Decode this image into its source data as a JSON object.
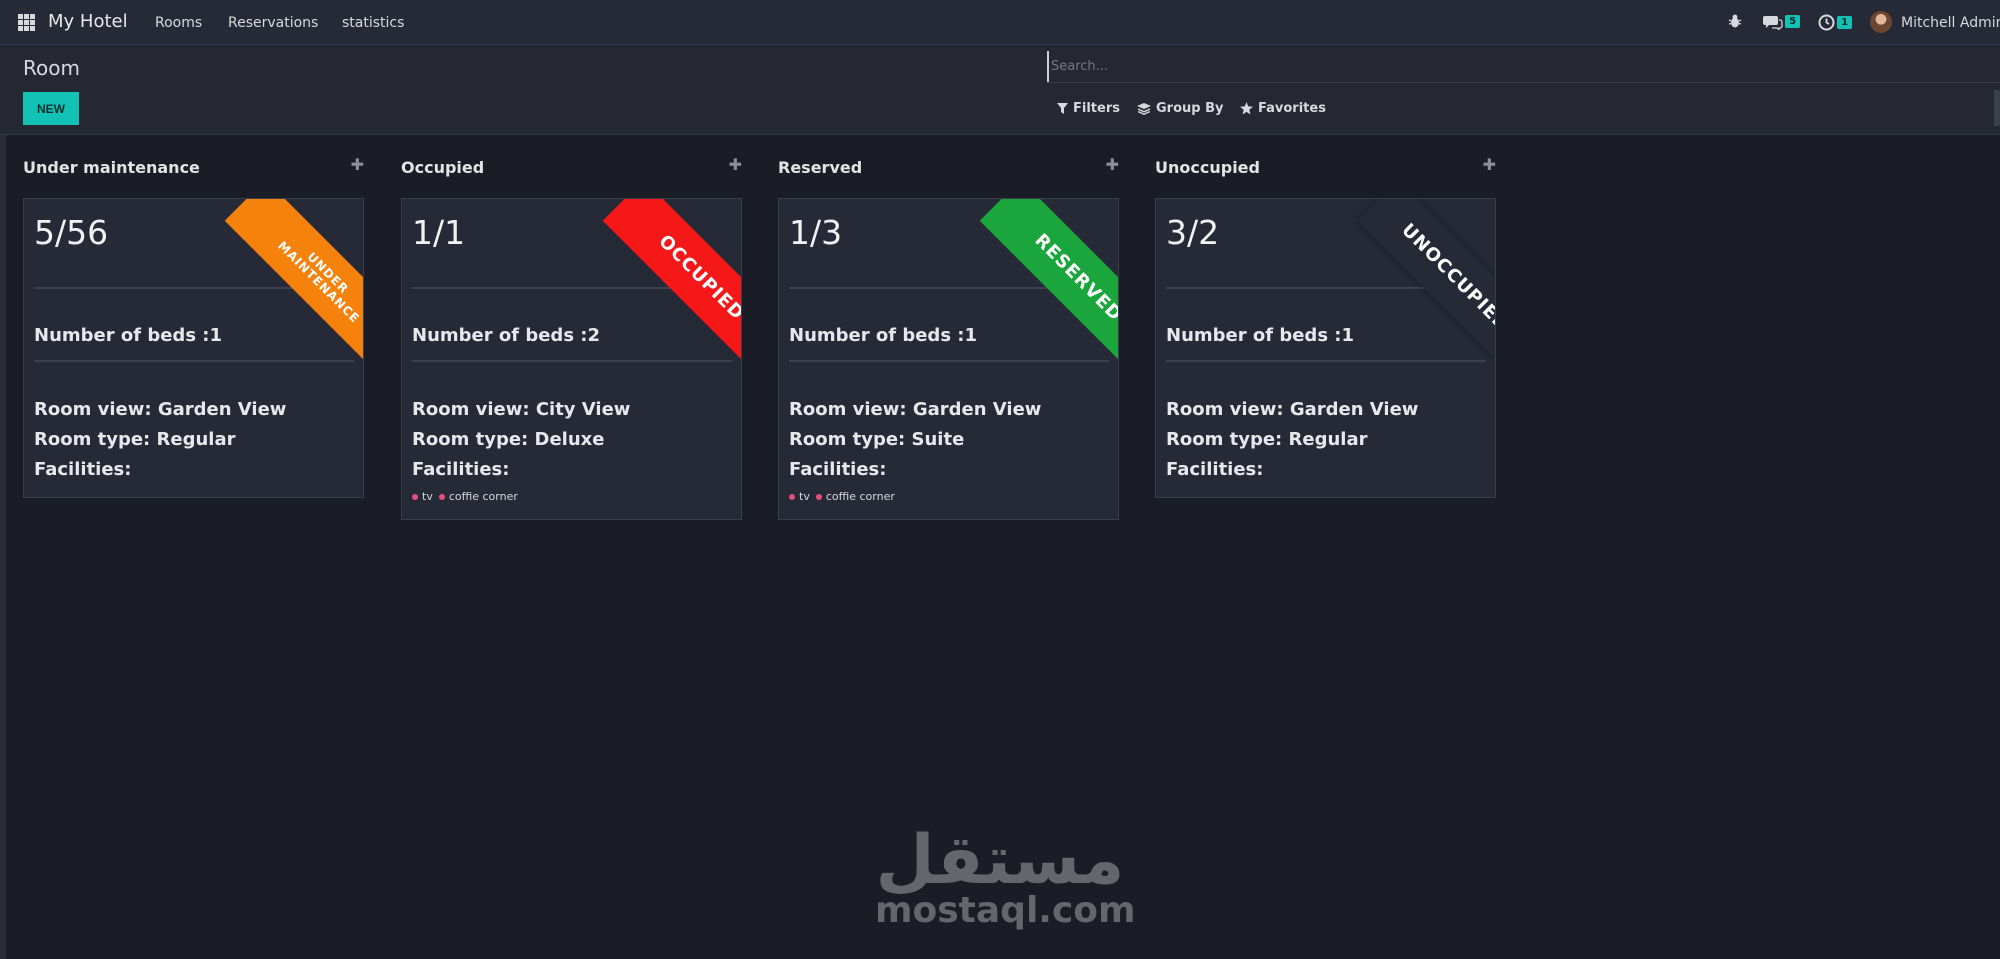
{
  "navbar": {
    "brand": "My Hotel",
    "menu": [
      "Rooms",
      "Reservations",
      "statistics"
    ],
    "chat_count": "5",
    "activity_count": "1",
    "user_name": "Mitchell Admin"
  },
  "control_panel": {
    "breadcrumb": "Room",
    "new_label": "NEW",
    "search_placeholder": "Search...",
    "filters_label": "Filters",
    "group_by_label": "Group By",
    "favorites_label": "Favorites"
  },
  "columns": [
    {
      "title": "Under maintenance",
      "card": {
        "name": "5/56",
        "beds": "Number of beds :1",
        "view": "Room view: Garden View",
        "type": "Room type: Regular",
        "facilities": "Facilities:",
        "tags": [],
        "ribbon": "UNDER MAINTENANCE",
        "ribbon_color": "#f5820d"
      }
    },
    {
      "title": "Occupied",
      "card": {
        "name": "1/1",
        "beds": "Number of beds :2",
        "view": "Room view: City View",
        "type": "Room type: Deluxe",
        "facilities": "Facilities:",
        "tags": [
          "tv",
          "coffie corner"
        ],
        "ribbon": "OCCUPIED",
        "ribbon_color": "#f51818"
      }
    },
    {
      "title": "Reserved",
      "card": {
        "name": "1/3",
        "beds": "Number of beds :1",
        "view": "Room view: Garden View",
        "type": "Room type: Suite",
        "facilities": "Facilities:",
        "tags": [
          "tv",
          "coffie corner"
        ],
        "ribbon": "RESERVED",
        "ribbon_color": "#1aa63d"
      }
    },
    {
      "title": "Unoccupied",
      "card": {
        "name": "3/2",
        "beds": "Number of beds :1",
        "view": "Room view: Garden View",
        "type": "Room type: Regular",
        "facilities": "Facilities:",
        "tags": [],
        "ribbon": "UNOCCUPIED",
        "ribbon_color": "#262936"
      }
    }
  ],
  "watermark": {
    "arabic": "مستقل",
    "latin": "mostaql.com"
  }
}
